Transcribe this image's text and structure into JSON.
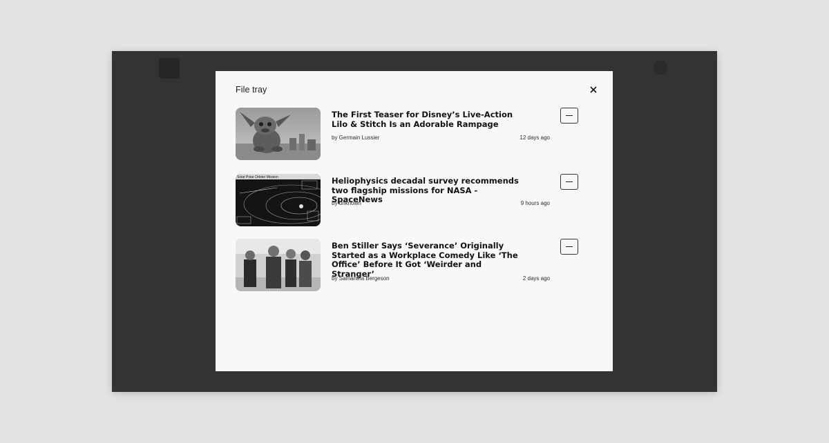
{
  "modal": {
    "title": "File tray",
    "close_icon": "close-icon"
  },
  "items": [
    {
      "title": "The First Teaser for Disney’s Live-Action Lilo & Stitch Is an Adorable Rampage",
      "author": "by Germain Lussier",
      "time": "12 days ago",
      "thumbnail": "stitch-photo",
      "remove_icon": "minus-icon"
    },
    {
      "title": "Heliophysics decadal survey recommends two flagship missions for NASA - SpaceNews",
      "author": "by unknown",
      "time": "9 hours ago",
      "thumbnail": "orbit-diagram",
      "thumbnail_caption": "Solar Polar Orbiter Mission",
      "remove_icon": "minus-icon"
    },
    {
      "title": "Ben Stiller Says ‘Severance’ Originally Started as a Workplace Comedy Like ‘The Office’ Before It Got ‘Weirder and Stranger’",
      "author": "by Samantha Bergeson",
      "time": "2 days ago",
      "thumbnail": "severance-cast-photo",
      "remove_icon": "minus-icon"
    }
  ]
}
